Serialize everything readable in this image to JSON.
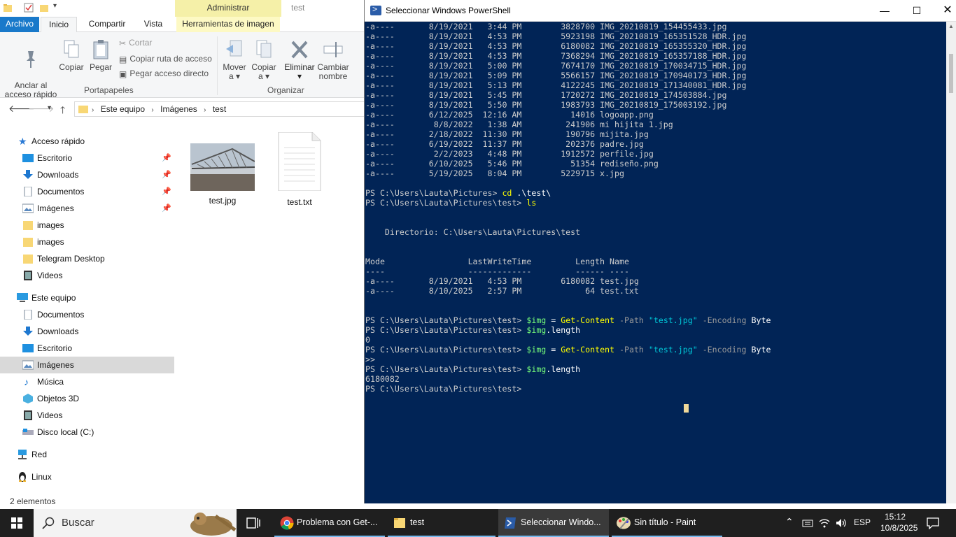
{
  "explorer": {
    "admin_tab": "Administrar",
    "folder_title": "test",
    "tabs": [
      "Archivo",
      "Inicio",
      "Compartir",
      "Vista",
      "Herramientas de imagen"
    ],
    "ribbon": {
      "anclar": "Anclar al\nacceso rápido",
      "copiar": "Copiar",
      "pegar": "Pegar",
      "cortar": "Cortar",
      "copiar_ruta": "Copiar ruta de acceso",
      "pegar_acceso": "Pegar acceso directo",
      "portapapeles": "Portapapeles",
      "mover": "Mover",
      "mover_sub": "a",
      "copiar_a": "Copiar",
      "copiar_a_sub": "a",
      "eliminar": "Eliminar",
      "cambiar": "Cambiar",
      "cambiar_sub": "nombre",
      "organizar": "Organizar"
    },
    "breadcrumb": [
      "Este equipo",
      "Imágenes",
      "test"
    ],
    "nav": {
      "acceso_rapido": "Acceso rápido",
      "quick": [
        "Escritorio",
        "Downloads",
        "Documentos",
        "Imágenes",
        "images",
        "images",
        "Telegram Desktop",
        "Videos"
      ],
      "este_equipo": "Este equipo",
      "pc": [
        "Documentos",
        "Downloads",
        "Escritorio",
        "Imágenes",
        "Música",
        "Objetos 3D",
        "Videos",
        "Disco local (C:)"
      ],
      "red": "Red",
      "linux": "Linux"
    },
    "files": [
      "test.jpg",
      "test.txt"
    ],
    "status": "2 elementos"
  },
  "powershell": {
    "title": "Seleccionar Windows PowerShell",
    "listing_top": [
      [
        "-a----",
        "8/19/2021",
        "3:44 PM",
        "3828700",
        "IMG_20210819_154455433.jpg"
      ],
      [
        "-a----",
        "8/19/2021",
        "4:53 PM",
        "5923198",
        "IMG_20210819_165351528_HDR.jpg"
      ],
      [
        "-a----",
        "8/19/2021",
        "4:53 PM",
        "6180082",
        "IMG_20210819_165355320_HDR.jpg"
      ],
      [
        "-a----",
        "8/19/2021",
        "4:53 PM",
        "7368294",
        "IMG_20210819_165357188_HDR.jpg"
      ],
      [
        "-a----",
        "8/19/2021",
        "5:00 PM",
        "7674170",
        "IMG_20210819_170034715_HDR.jpg"
      ],
      [
        "-a----",
        "8/19/2021",
        "5:09 PM",
        "5566157",
        "IMG_20210819_170940173_HDR.jpg"
      ],
      [
        "-a----",
        "8/19/2021",
        "5:13 PM",
        "4122245",
        "IMG_20210819_171340081_HDR.jpg"
      ],
      [
        "-a----",
        "8/19/2021",
        "5:45 PM",
        "1720272",
        "IMG_20210819_174503884.jpg"
      ],
      [
        "-a----",
        "8/19/2021",
        "5:50 PM",
        "1983793",
        "IMG_20210819_175003192.jpg"
      ],
      [
        "-a----",
        "6/12/2025",
        "12:16 AM",
        "14016",
        "logoapp.png"
      ],
      [
        "-a----",
        "8/8/2022",
        "1:38 AM",
        "241906",
        "mi hijita 1.jpg"
      ],
      [
        "-a----",
        "2/18/2022",
        "11:30 PM",
        "190796",
        "mijita.jpg"
      ],
      [
        "-a----",
        "6/19/2022",
        "11:37 PM",
        "202376",
        "padre.jpg"
      ],
      [
        "-a----",
        "2/2/2023",
        "4:48 PM",
        "1912572",
        "perfile.jpg"
      ],
      [
        "-a----",
        "6/10/2025",
        "5:46 PM",
        "51354",
        "rediseño.png"
      ],
      [
        "-a----",
        "5/19/2025",
        "8:04 PM",
        "5229715",
        "x.jpg"
      ]
    ],
    "prompt_pictures": "PS C:\\Users\\Lauta\\Pictures>",
    "prompt_test": "PS C:\\Users\\Lauta\\Pictures\\test>",
    "cmd_cd": "cd",
    "cmd_cd_arg": ".\\test\\",
    "cmd_ls": "ls",
    "directorio": "    Directorio: C:\\Users\\Lauta\\Pictures\\test",
    "header": "Mode                 LastWriteTime         Length Name",
    "header_sep": "----                 -------------         ------ ----",
    "listing_test": [
      [
        "-a----",
        "8/19/2021",
        "4:53 PM",
        "6180082",
        "test.jpg"
      ],
      [
        "-a----",
        "8/10/2025",
        "2:57 PM",
        "64",
        "test.txt"
      ]
    ],
    "var_img": "$img",
    "eq": "=",
    "get_content": "Get-Content",
    "p_path": "-Path",
    "s_file": "\"test.jpg\"",
    "p_enc": "-Encoding",
    "byte": "Byte",
    "var_len": "$img",
    "dot_length": ".length",
    "out_zero": "0",
    "continuation": ">>",
    "out_len": "6180082"
  },
  "taskbar": {
    "search": "Buscar",
    "apps": [
      "Problema con Get-...",
      "test",
      "Seleccionar Windo...",
      "Sin título - Paint"
    ],
    "lang": "ESP",
    "time": "15:12",
    "date": "10/8/2025"
  }
}
